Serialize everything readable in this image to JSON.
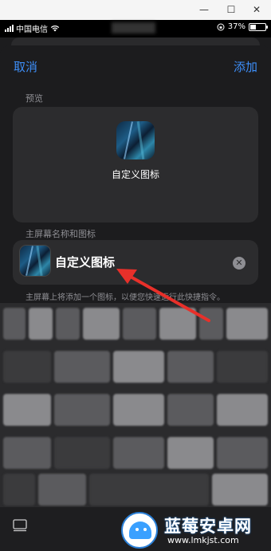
{
  "window": {
    "minimize": "—",
    "maximize": "☐",
    "close": "✕"
  },
  "status_bar": {
    "carrier": "中国电信",
    "battery": "37%",
    "battery_level": 0.37
  },
  "nav": {
    "cancel": "取消",
    "add": "添加"
  },
  "preview": {
    "section_label": "预览",
    "app_name": "自定义图标"
  },
  "home_screen": {
    "section_label": "主屏幕名称和图标",
    "name_value": "自定义图标",
    "hint": "主屏幕上将添加一个图标，以便您快速运行此快捷指令。"
  },
  "colors": {
    "accent": "#3d8ef8",
    "sheet": "#1c1c1e",
    "card": "#2c2c2e",
    "annotation_arrow": "#e8302a"
  },
  "icons": [
    "minimize-icon",
    "maximize-icon",
    "close-icon",
    "signal-icon",
    "wifi-icon",
    "lock-rotation-icon",
    "battery-icon",
    "clear-text-icon",
    "keyboard-switch-icon",
    "annotation-arrow"
  ],
  "watermark": {
    "title": "蓝莓安卓网",
    "url": "www.lmkjst.com"
  }
}
